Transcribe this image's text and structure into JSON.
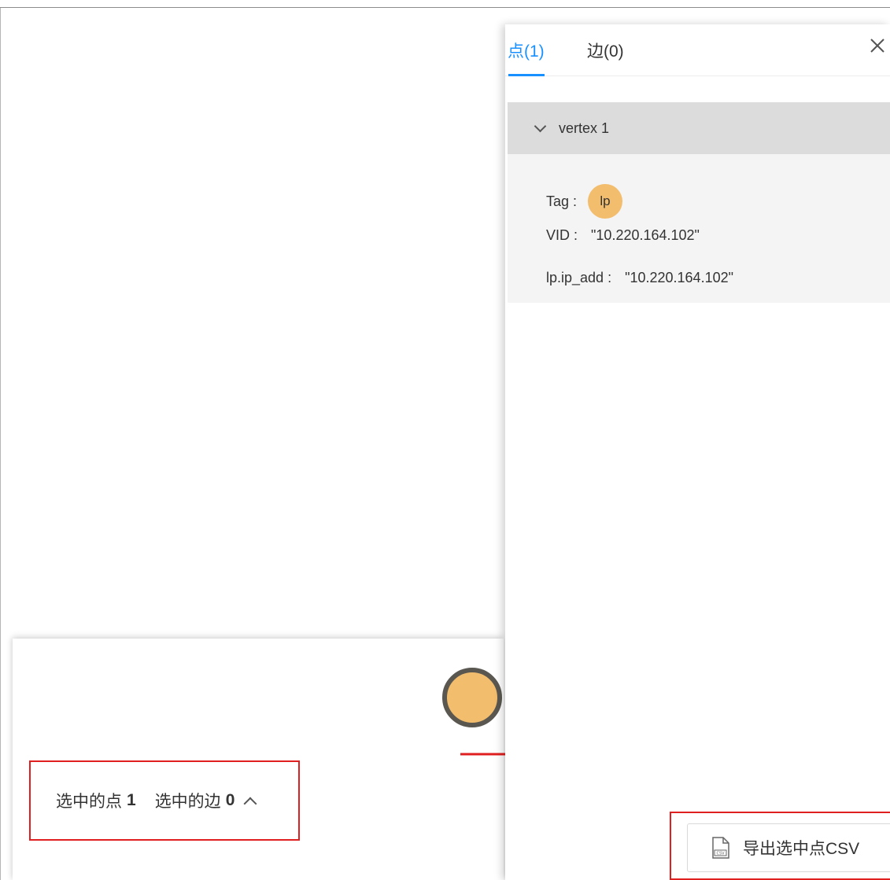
{
  "canvas": {
    "stats": {
      "selected_vertices_label": "选中的点",
      "selected_vertices_count": "1",
      "selected_edges_label": "选中的边",
      "selected_edges_count": "0"
    },
    "node_color": "#f2bd6c"
  },
  "side_panel": {
    "tabs": [
      {
        "label": "点(1)",
        "active": true
      },
      {
        "label": "边(0)",
        "active": false
      }
    ],
    "vertex": {
      "title": "vertex 1",
      "tag_key": "Tag :",
      "tag_value": "lp",
      "vid_key": "VID :",
      "vid_value": "\"10.220.164.102\"",
      "ip_key": "lp.ip_add :",
      "ip_value": "\"10.220.164.102\""
    },
    "export_label": "导出选中点CSV"
  },
  "colors": {
    "accent": "#1890ff",
    "highlight_border": "#e02020",
    "tag_chip": "#f2bd6c"
  }
}
